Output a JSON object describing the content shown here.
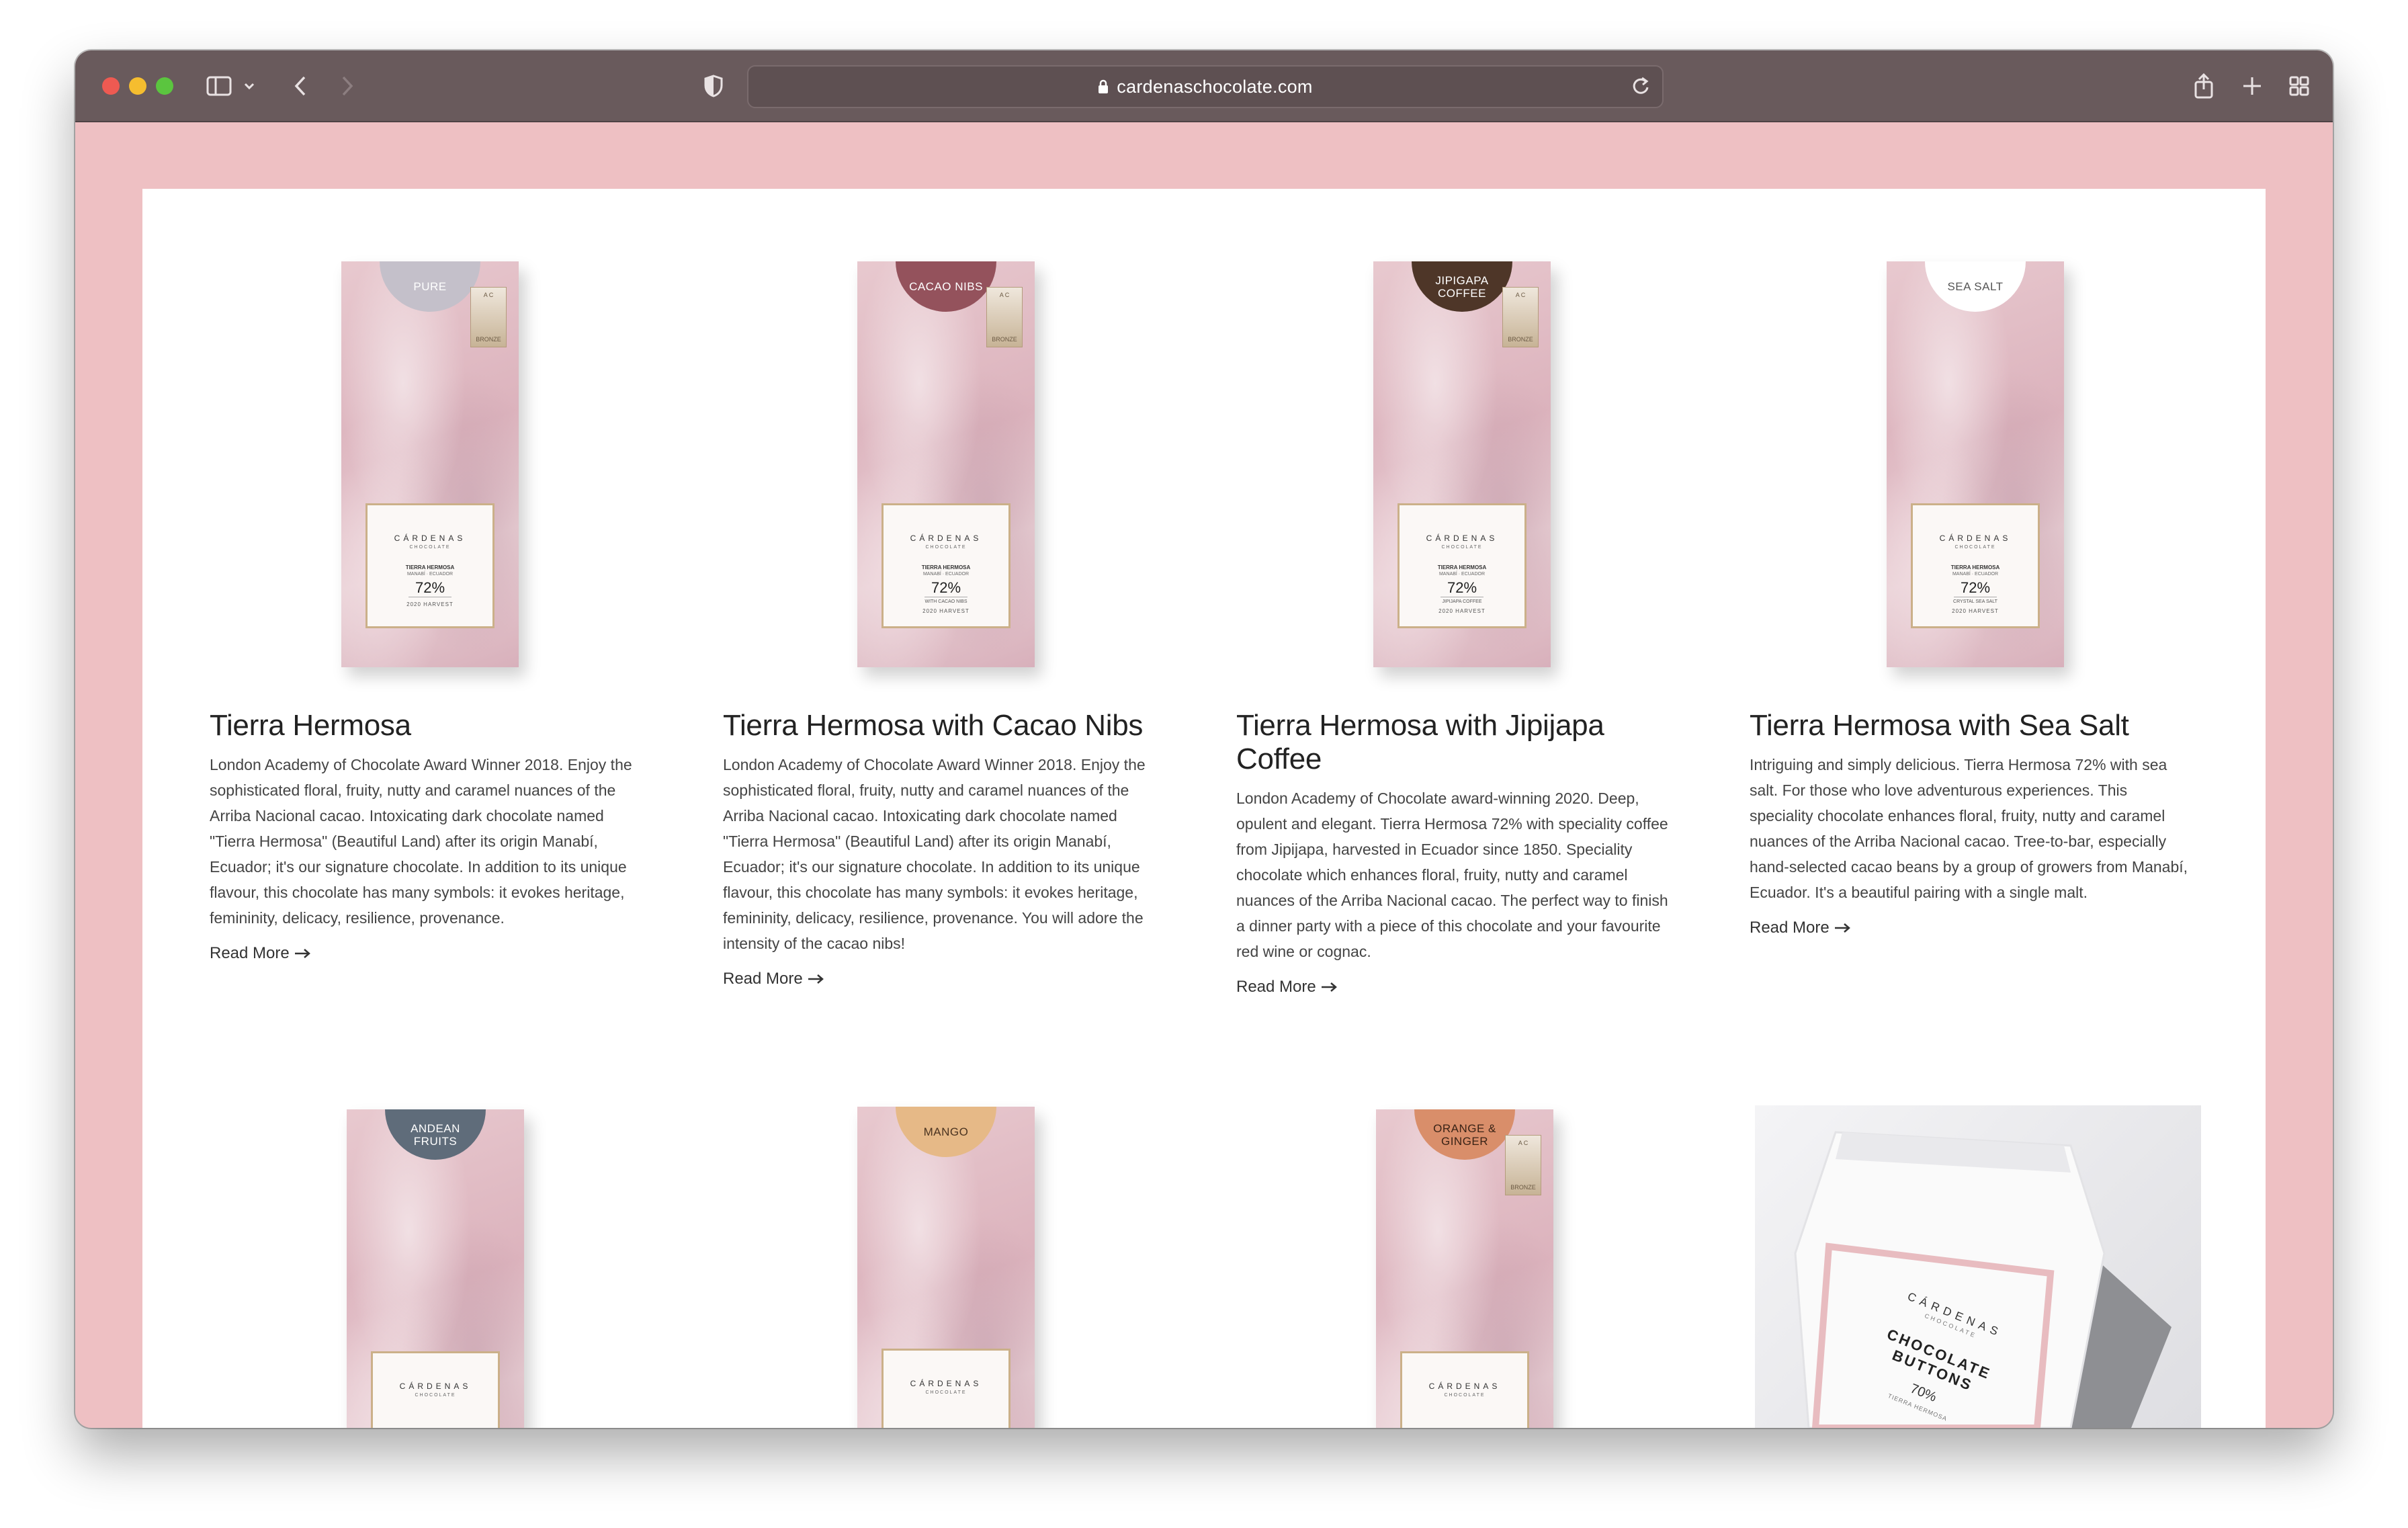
{
  "browser": {
    "url": "cardenaschocolate.com"
  },
  "products": [
    {
      "badge": "PURE",
      "badge_color": "#c4c0ca",
      "flavor_note": "",
      "title": "Tierra Hermosa",
      "description": "London Academy of Chocolate Award Winner 2018. Enjoy the sophisticated floral, fruity, nutty and caramel nuances of the Arriba Nacional cacao. Intoxicating dark chocolate named \"Tierra Hermosa\" (Beautiful Land) after its origin Manabí, Ecuador; it's our signature chocolate. In addition to its unique flavour, this chocolate has many symbols: it evokes heritage, femininity, delicacy, resilience, provenance.",
      "read_more": "Read More"
    },
    {
      "badge": "CACAO NIBS",
      "badge_color": "#94525c",
      "flavor_note": "WITH CACAO NIBS",
      "title": "Tierra Hermosa with Cacao Nibs",
      "description": "London Academy of Chocolate Award Winner 2018. Enjoy the sophisticated floral, fruity, nutty and caramel nuances of the Arriba Nacional cacao. Intoxicating dark chocolate named \"Tierra Hermosa\" (Beautiful Land) after its origin Manabí, Ecuador; it's our signature chocolate. In addition to its unique flavour, this chocolate has many symbols: it evokes heritage, femininity, delicacy, resilience, provenance. You will adore the intensity of the cacao nibs!",
      "read_more": "Read More"
    },
    {
      "badge": "JIPIGAPA COFFEE",
      "badge_color": "#4e3628",
      "flavor_note": "JIPIJAPA COFFEE",
      "title": "Tierra Hermosa with Jipijapa Coffee",
      "description": "London Academy of Chocolate award-winning 2020. Deep, opulent and elegant. Tierra Hermosa 72% with speciality coffee from Jipijapa, harvested in Ecuador since 1850. Speciality chocolate which enhances floral, fruity, nutty and caramel nuances of the Arriba Nacional cacao. The perfect way to finish a dinner party with a piece of this chocolate and your favourite red wine or cognac.",
      "read_more": "Read More"
    },
    {
      "badge": "SEA SALT",
      "badge_color": "#ffffff",
      "flavor_note": "CRYSTAL SEA SALT",
      "title": "Tierra Hermosa with Sea Salt",
      "description": "Intriguing and simply delicious. Tierra Hermosa 72% with sea salt. For those who love adventurous experiences. This speciality chocolate enhances floral, fruity, nutty and caramel nuances of the Arriba Nacional cacao. Tree-to-bar, especially hand-selected cacao beans by a group of growers from Manabí, Ecuador. It's a beautiful pairing with a single malt.",
      "read_more": "Read More"
    }
  ],
  "products_row2": [
    {
      "badge": "ANDEAN FRUITS",
      "badge_color": "#5f6c7a"
    },
    {
      "badge": "MANGO",
      "badge_color": "#e6b987"
    },
    {
      "badge": "ORANGE & GINGER",
      "badge_color": "#d98e6a"
    }
  ],
  "pack_label": {
    "brand": "CÁRDENAS",
    "sub": "CHOCOLATE",
    "line1": "TIERRA HERMOSA",
    "origin": "MANABÍ · ECUADOR",
    "percent": "72%",
    "harvest": "2020 HARVEST",
    "medal_top": "A C",
    "medal_bottom": "BRONZE"
  },
  "bag": {
    "brand": "CÁRDENAS",
    "sub": "CHOCOLATE",
    "line1": "CHOCOLATE",
    "line2": "BUTTONS",
    "percent": "70%",
    "small": "TIERRA HERMOSA"
  }
}
